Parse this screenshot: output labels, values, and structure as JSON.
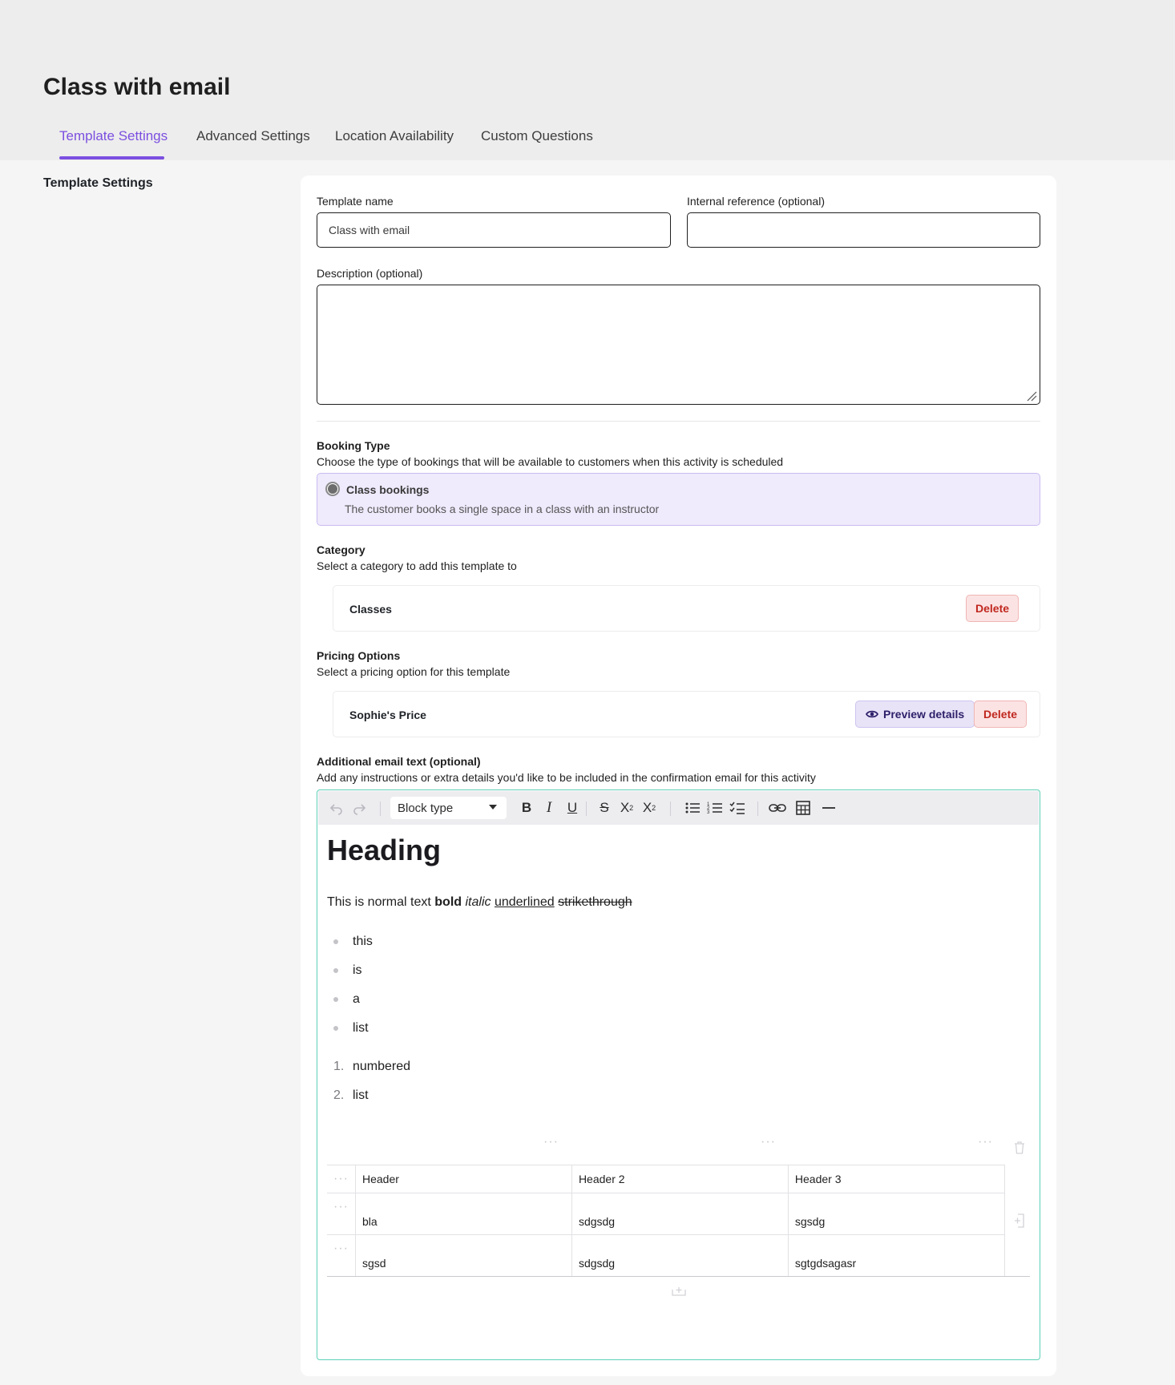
{
  "page": {
    "title": "Class with email",
    "tabs": [
      {
        "label": "Template Settings",
        "active": true
      },
      {
        "label": "Advanced Settings",
        "active": false
      },
      {
        "label": "Location Availability",
        "active": false
      },
      {
        "label": "Custom Questions",
        "active": false
      }
    ],
    "side_title": "Template Settings"
  },
  "colors": {
    "accent": "#7b4fe0",
    "danger": "#c0281f",
    "editor_border": "#5fd0b7",
    "booking_bg": "#efeafc"
  },
  "form": {
    "template_name": {
      "label": "Template name",
      "value": "Class with email"
    },
    "internal_ref": {
      "label": "Internal reference (optional)",
      "value": "",
      "placeholder": ""
    },
    "description": {
      "label": "Description (optional)",
      "value": ""
    },
    "booking": {
      "title": "Booking Type",
      "help": "Choose the type of bookings that will be available to customers when this activity is scheduled",
      "option_label": "Class bookings",
      "option_desc": "The customer books a single space in a class with an instructor"
    },
    "category": {
      "title": "Category",
      "help": "Select a category to add this template to",
      "item": "Classes",
      "delete": "Delete"
    },
    "pricing": {
      "title": "Pricing Options",
      "help": "Select a pricing option for this template",
      "item": "Sophie's Price",
      "preview": "Preview details",
      "delete": "Delete"
    },
    "email": {
      "title": "Additional email text (optional)",
      "help": "Add any instructions or extra details you'd like to be included in the confirmation email for this activity"
    }
  },
  "editor": {
    "block_type": "Block type",
    "toolbar_icons": [
      "undo-icon",
      "redo-icon",
      "bold-icon",
      "italic-icon",
      "underline-icon",
      "strikethrough-icon",
      "superscript-icon",
      "subscript-icon",
      "bullet-list-icon",
      "numbered-list-icon",
      "checklist-icon",
      "link-icon",
      "table-icon",
      "horizontal-rule-icon"
    ],
    "heading": "Heading",
    "para": {
      "normal": "This is normal text",
      "bold": "bold",
      "italic": "italic",
      "underlined": "underlined",
      "strike": "strikethrough"
    },
    "bullets": [
      "this",
      "is",
      "a",
      "list"
    ],
    "numbered": [
      {
        "n": "1.",
        "text": "numbered"
      },
      {
        "n": "2.",
        "text": "list"
      }
    ],
    "table": {
      "headers": [
        "Header",
        "Header 2",
        "Header 3"
      ],
      "rows": [
        [
          "bla",
          "sdgsdg",
          "sgsdg"
        ],
        [
          "sgsd",
          "sdgsdg",
          "sgtgdsagasr"
        ]
      ]
    }
  }
}
